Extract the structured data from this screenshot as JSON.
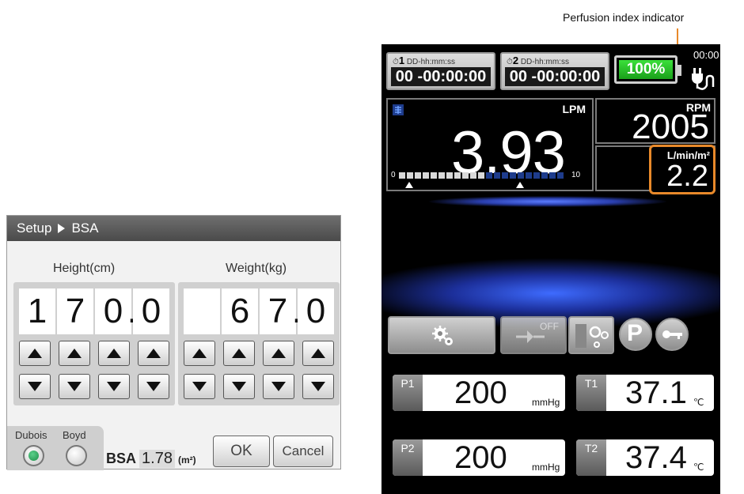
{
  "dialog": {
    "breadcrumb_root": "Setup",
    "breadcrumb_page": "BSA",
    "height_label": "Height(cm)",
    "weight_label": "Weight(kg)",
    "height_digits": [
      "1",
      "7",
      "0",
      "0"
    ],
    "height_decimal_point": ".",
    "weight_digits": [
      "",
      "6",
      "7",
      "0"
    ],
    "weight_decimal_point": ".",
    "formula_dubois_label": "Dubois",
    "formula_boyd_label": "Boyd",
    "formula_selected": "Dubois",
    "bsa_label": "BSA",
    "bsa_value": "1.78",
    "bsa_unit": "(m²)",
    "ok_label": "OK",
    "cancel_label": "Cancel"
  },
  "device": {
    "annotation": "Perfusion index indicator",
    "timer1": {
      "number": "1",
      "format": "DD-hh:mm:ss",
      "value": "00 -00:00:00"
    },
    "timer2": {
      "number": "2",
      "format": "DD-hh:mm:ss",
      "value": "00 -00:00:00"
    },
    "battery_percent": "100%",
    "clock_text": "00:00",
    "flow": {
      "unit": "LPM",
      "value": "3.93",
      "scale_min": "0",
      "scale_max": "10",
      "filled_segments": 11,
      "total_segments": 21
    },
    "rpm": {
      "unit": "RPM",
      "value": "2005"
    },
    "perfusion_index": {
      "unit": "L/min/m²",
      "value": "2.2"
    },
    "off_label": "OFF",
    "p1": {
      "tag": "P1",
      "value": "200",
      "unit": "mmHg"
    },
    "p2": {
      "tag": "P2",
      "value": "200",
      "unit": "mmHg"
    },
    "t1": {
      "tag": "T1",
      "value": "37.1",
      "unit": "℃"
    },
    "t2": {
      "tag": "T2",
      "value": "37.4",
      "unit": "℃"
    },
    "colors": {
      "highlight": "#e8892a",
      "radio_on": "#1f8f4a",
      "battery": "#1aa01a",
      "bar_filled": "#d9d9d9",
      "bar_empty": "#1e3c8c"
    }
  }
}
